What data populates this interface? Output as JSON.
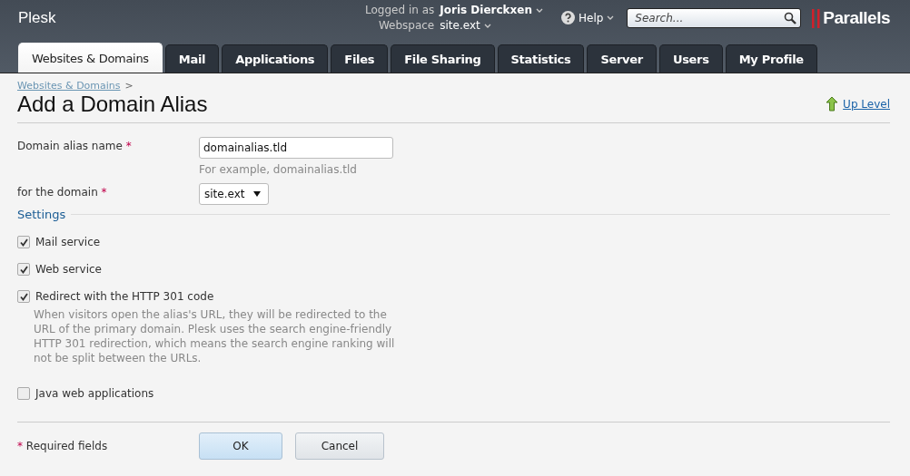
{
  "header": {
    "product": "Plesk",
    "logged_in_label": "Logged in as",
    "user": "Joris Dierckxen",
    "webspace_label": "Webspace",
    "webspace": "site.ext",
    "help": "Help",
    "search": {
      "placeholder": "Search..."
    },
    "brand": "Parallels"
  },
  "tabs": [
    {
      "label": "Websites & Domains",
      "selected": true
    },
    {
      "label": "Mail",
      "selected": false
    },
    {
      "label": "Applications",
      "selected": false
    },
    {
      "label": "Files",
      "selected": false
    },
    {
      "label": "File Sharing",
      "selected": false
    },
    {
      "label": "Statistics",
      "selected": false
    },
    {
      "label": "Server",
      "selected": false
    },
    {
      "label": "Users",
      "selected": false
    },
    {
      "label": "My Profile",
      "selected": false
    }
  ],
  "breadcrumb": {
    "link": "Websites & Domains",
    "separator": ">"
  },
  "title": "Add a Domain Alias",
  "up_level": "Up Level",
  "fields": [
    {
      "kind": "text",
      "label": "Domain alias name",
      "required_mark": "*",
      "value": "domainalias.tld",
      "hint": "For example, domainalias.tld"
    },
    {
      "kind": "select",
      "label": "for the domain",
      "required_mark": "*",
      "value": "site.ext"
    }
  ],
  "settings": {
    "title": "Settings",
    "options": [
      {
        "label": "Mail service",
        "checked": true
      },
      {
        "label": "Web service",
        "checked": true
      },
      {
        "label": "Redirect with the HTTP 301 code",
        "checked": true,
        "description": "When visitors open the alias's URL, they will be redirected to the URL of the primary domain. Plesk uses the search engine-friendly HTTP 301 redirection, which means the search engine ranking will not be split between the URLs."
      },
      {
        "label": "Java web applications",
        "checked": false
      }
    ]
  },
  "footer": {
    "required_mark": "*",
    "required_note": "Required fields",
    "buttons": [
      {
        "label": "OK",
        "kind": "primary"
      },
      {
        "label": "Cancel",
        "kind": "secondary"
      }
    ]
  }
}
